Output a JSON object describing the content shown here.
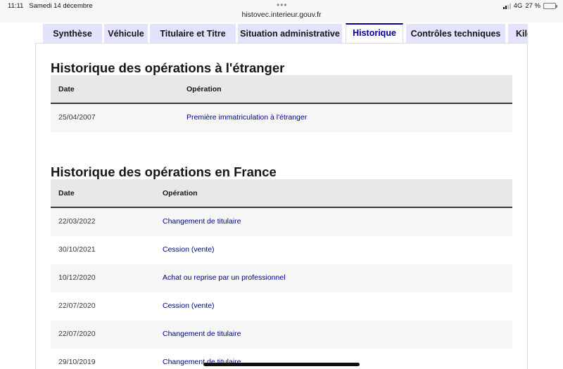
{
  "status_bar": {
    "time": "11:11",
    "date": "Samedi 14 décembre",
    "url": "histovec.interieur.gouv.fr",
    "network": "4G",
    "battery": "27 %",
    "battery_level": 0.27
  },
  "tabs": [
    {
      "label": "Synthèse",
      "active": false
    },
    {
      "label": "Véhicule",
      "active": false
    },
    {
      "label": "Titulaire et Titre",
      "active": false
    },
    {
      "label": "Situation administrative",
      "active": false
    },
    {
      "label": "Historique",
      "active": true
    },
    {
      "label": "Contrôles techniques",
      "active": false
    },
    {
      "label": "Kilo",
      "active": false
    }
  ],
  "foreign": {
    "title": "Historique des opérations à l'étranger",
    "col_date": "Date",
    "col_op": "Opération",
    "rows": [
      {
        "date": "25/04/2007",
        "op": "Première immatriculation à l'étranger"
      }
    ]
  },
  "france": {
    "title": "Historique des opérations en France",
    "col_date": "Date",
    "col_op": "Opération",
    "rows": [
      {
        "date": "22/03/2022",
        "op": "Changement de titulaire"
      },
      {
        "date": "30/10/2021",
        "op": "Cession (vente)"
      },
      {
        "date": "10/12/2020",
        "op": "Achat ou reprise par un professionnel"
      },
      {
        "date": "22/07/2020",
        "op": "Cession (vente)"
      },
      {
        "date": "22/07/2020",
        "op": "Changement de titulaire"
      },
      {
        "date": "29/10/2019",
        "op": "Changement de titulaire"
      }
    ]
  }
}
